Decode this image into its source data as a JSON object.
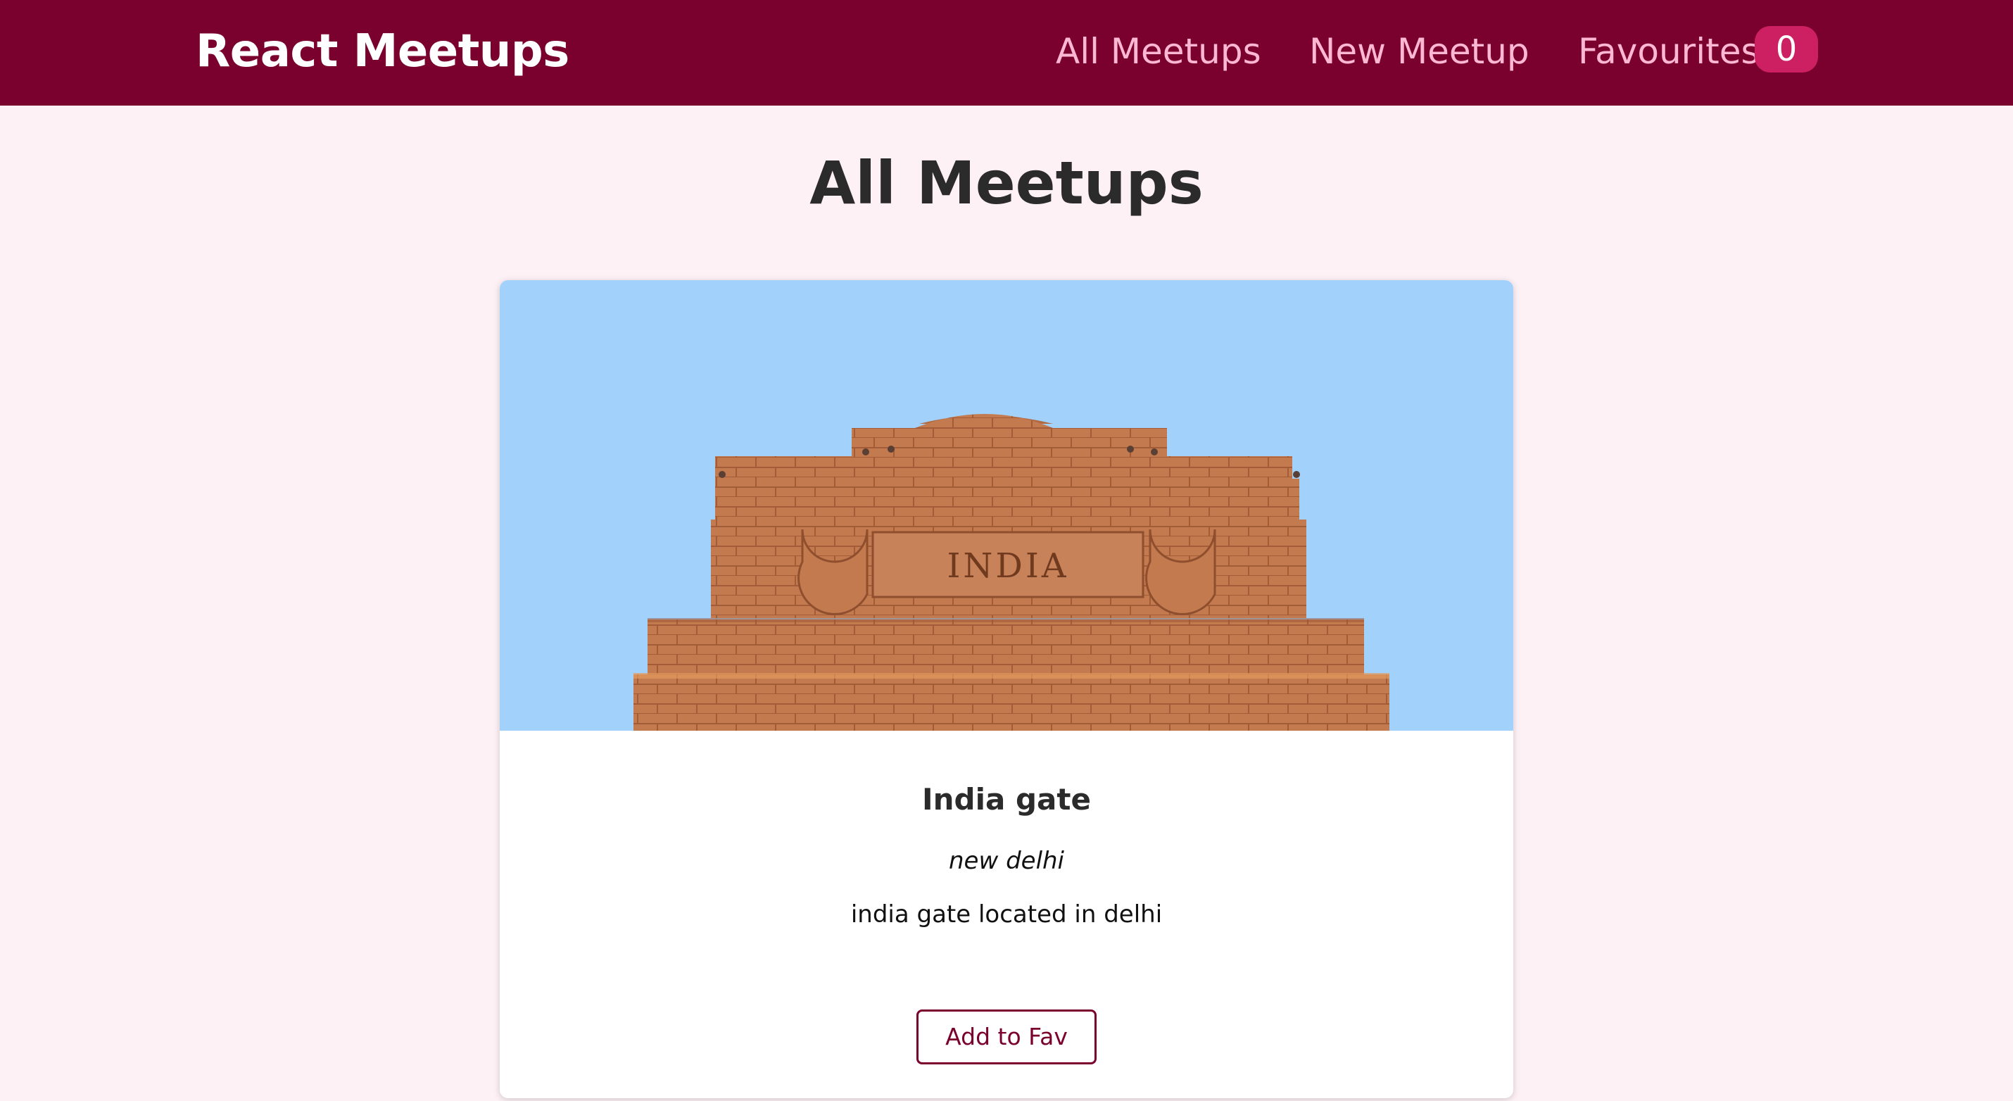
{
  "header": {
    "logo": "React Meetups",
    "nav": {
      "all_meetups": "All Meetups",
      "new_meetup": "New Meetup",
      "favourites": "Favourites",
      "favourites_count": "0"
    }
  },
  "main": {
    "title": "All Meetups",
    "meetups": [
      {
        "image_alt": "India gate",
        "image_text": "INDIA",
        "title": "India gate",
        "address": "new delhi",
        "description": "india gate located in delhi",
        "button_label": "Add to Fav"
      }
    ]
  },
  "colors": {
    "header_bg": "#7a002e",
    "page_bg": "#fdf1f5",
    "nav_text": "#fcb8d1",
    "badge_bg": "#cc2062",
    "button_accent": "#7a002e",
    "sky": "#a2d2fb",
    "sandstone": "#c37a4e"
  }
}
